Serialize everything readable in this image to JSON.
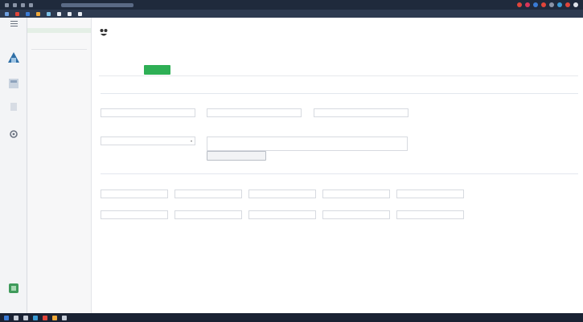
{
  "colors": {
    "accent_green": "#2eaf55",
    "heading_blue": "#3f63a8"
  },
  "browser": {
    "icons": [
      "back-arrow-icon",
      "forward-arrow-icon",
      "reload-icon",
      "home-icon"
    ]
  },
  "taskbar": {
    "icons": [
      "windows-logo-icon",
      "search-icon",
      "task-view-icon",
      "app-icon"
    ]
  },
  "rail": {
    "icons": [
      "home-icon",
      "dashboard-icon",
      "files-icon",
      "settings-icon",
      "app-tile-icon"
    ]
  },
  "main": {
    "logo_icon": "app-logo-icon",
    "subtabs": [
      {
        "active": false
      },
      {
        "active": false
      },
      {
        "active": true
      }
    ]
  }
}
